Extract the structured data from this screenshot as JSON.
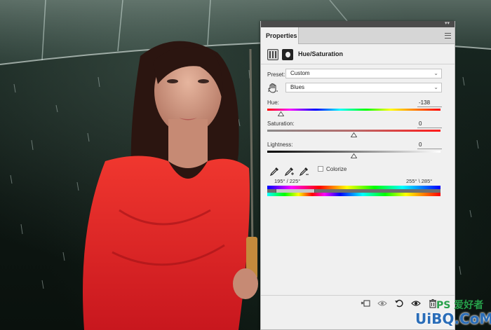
{
  "panel": {
    "tab_label": "Properties",
    "adjustment_title": "Hue/Saturation",
    "preset_label": "Preset:",
    "preset_value": "Custom",
    "channel_value": "Blues",
    "hue_label": "Hue:",
    "hue_value": "-138",
    "hue_level_percent": 8,
    "saturation_label": "Saturation:",
    "saturation_value": "0",
    "saturation_level_percent": 50,
    "lightness_label": "Lightness:",
    "lightness_value": "0",
    "lightness_level_percent": 50,
    "colorize_label": "Colorize",
    "colorize_checked": false,
    "range_left": "195° /  225°",
    "range_right": "255° \\ 285°"
  },
  "icons": {
    "targeted_adjustment": "hand-icon",
    "eyedropper": "eyedropper-icon",
    "eyedropper_add": "eyedropper-plus-icon",
    "eyedropper_subtract": "eyedropper-minus-icon",
    "clip_to_layer": "clip-layer-icon",
    "view_previous": "view-previous-icon",
    "reset": "reset-icon",
    "visibility": "eye-icon",
    "delete": "trash-icon"
  },
  "watermark": {
    "seal": "PS 爱好者",
    "text": "UiBQ.CoM"
  },
  "colors": {
    "panel_bg": "#f0f0f0",
    "dress_red": "#e8262a"
  }
}
